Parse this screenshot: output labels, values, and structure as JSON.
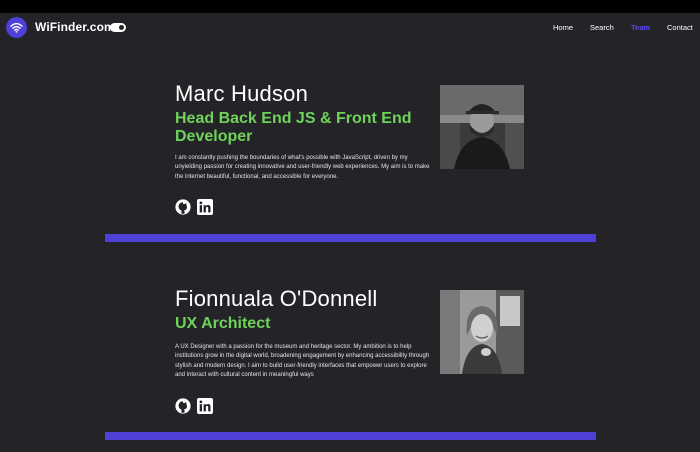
{
  "navbar": {
    "brand": "WiFinder.com",
    "links": [
      {
        "label": "Home"
      },
      {
        "label": "Search"
      },
      {
        "label": "Team",
        "active": true
      },
      {
        "label": "Contact"
      }
    ],
    "toggle_on": true
  },
  "team": [
    {
      "name": "Marc Hudson",
      "role": "Head Back End JS & Front End Developer",
      "bio": "I am constantly pushing the boundaries of what's possible with JavaScript, driven by my unyielding passion for creating innovative and user-friendly web experiences. My aim is to make the internet beautiful, functional, and accessible for everyone."
    },
    {
      "name": "Fionnuala O'Donnell",
      "role": "UX Architect",
      "bio": "A UX Designer with a passion for the museum and heritage sector. My ambition is to help institutions grow in the digital world, broadening engagement by enhancing accessibility through stylish and modern design. I aim to build user-friendly interfaces that empower users to explore and interact with cultural content in meaningful ways"
    }
  ],
  "colors": {
    "background": "#232328",
    "accent": "#4f40d8",
    "role_green": "#6fd35a",
    "active_link": "#5b4cf0"
  },
  "icons": [
    "wifi-icon",
    "github-icon",
    "linkedin-icon"
  ]
}
